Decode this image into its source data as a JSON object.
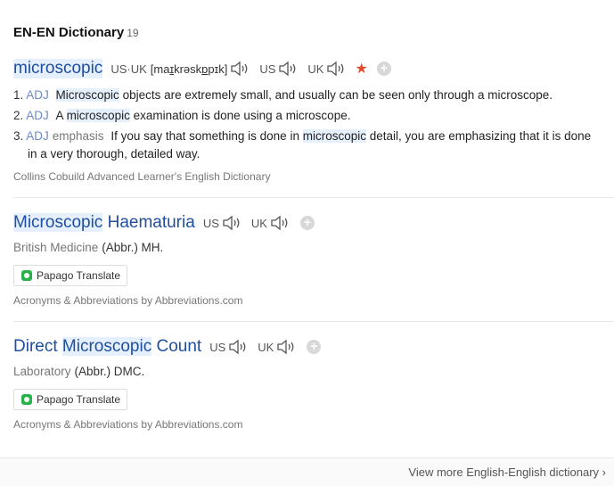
{
  "header": {
    "title": "EN-EN Dictionary",
    "count": "19"
  },
  "entries": [
    {
      "word": "microscopic",
      "pron_label": "US·UK",
      "phonetic_a": "[ma",
      "phonetic_u1": "ɪ",
      "phonetic_b": "krəsk",
      "phonetic_u2": "ɒ",
      "phonetic_c": "pɪk]",
      "us": "US",
      "uk": "UK",
      "definitions": [
        {
          "num": "1.",
          "pos": "ADJ",
          "hl": "Microscopic",
          "text": " objects are extremely small, and usually can be seen only through a microscope."
        },
        {
          "num": "2.",
          "pos": "ADJ",
          "pre": "A ",
          "hl": "microscopic",
          "text": " examination is done using a microscope."
        },
        {
          "num": "3.",
          "pos": "ADJ",
          "tag": "emphasis",
          "pre": "If you say that something is done in ",
          "hl": "microscopic",
          "text": " detail, you are emphasizing that it is done",
          "text2": "in a very thorough, detailed way."
        }
      ],
      "source": "Collins Cobuild Advanced Learner's English Dictionary"
    },
    {
      "word_hl": "Microscopic",
      "word_rest": " Haematuria",
      "us": "US",
      "uk": "UK",
      "category": "British Medicine",
      "abbr": "(Abbr.) MH.",
      "translate": "Papago Translate",
      "source": "Acronyms & Abbreviations by Abbreviations.com"
    },
    {
      "word_pre": "Direct ",
      "word_hl": "Microscopic",
      "word_rest": " Count",
      "us": "US",
      "uk": "UK",
      "category": "Laboratory",
      "abbr": "(Abbr.) DMC.",
      "translate": "Papago Translate",
      "source": "Acronyms & Abbreviations by Abbreviations.com"
    }
  ],
  "footer": {
    "more": "View more English-English dictionary ›"
  },
  "colors": {
    "accent": "#1f4e9f",
    "highlight": "#e5f0fc",
    "star": "#e24b2c"
  }
}
